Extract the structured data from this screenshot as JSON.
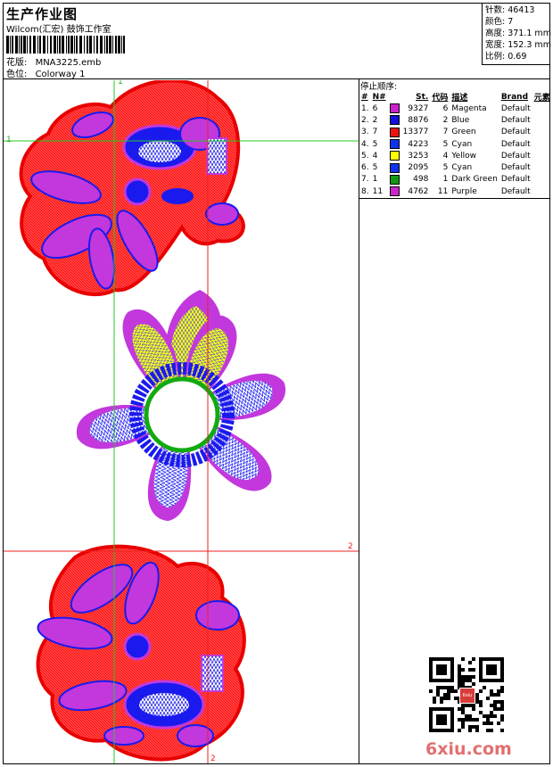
{
  "header": {
    "title": "生产作业图",
    "company": "Wilcom(汇宏) 鼓饰工作室",
    "design_label": "花版:",
    "design_file": "MNA3225.emb",
    "colorway_label": "色位:",
    "colorway": "Colorway 1"
  },
  "stats": {
    "stitches": "针数: 46413",
    "colors": "颜色: 7",
    "height": "高度: 371.1 mm",
    "width": "宽度: 152.3 mm",
    "scale": "比例: 0.69"
  },
  "stop_sequence": {
    "label": "停止顺序:",
    "columns": [
      "#",
      "N#",
      "",
      "St.",
      "代码",
      "描述",
      "Brand",
      "元素"
    ],
    "rows": [
      {
        "num": "1.",
        "n": "6",
        "color": "#cc22cc",
        "st": "9327",
        "code": "6",
        "desc": "Magenta",
        "brand": "Default"
      },
      {
        "num": "2.",
        "n": "2",
        "color": "#1111dd",
        "st": "8876",
        "code": "2",
        "desc": "Blue",
        "brand": "Default"
      },
      {
        "num": "3.",
        "n": "7",
        "color": "#ee1111",
        "st": "13377",
        "code": "7",
        "desc": "Green",
        "brand": "Default"
      },
      {
        "num": "4.",
        "n": "5",
        "color": "#1133ee",
        "st": "4223",
        "code": "5",
        "desc": "Cyan",
        "brand": "Default"
      },
      {
        "num": "5.",
        "n": "4",
        "color": "#ffff00",
        "st": "3253",
        "code": "4",
        "desc": "Yellow",
        "brand": "Default"
      },
      {
        "num": "6.",
        "n": "5",
        "color": "#1133ee",
        "st": "2095",
        "code": "5",
        "desc": "Cyan",
        "brand": "Default"
      },
      {
        "num": "7.",
        "n": "1",
        "color": "#119911",
        "st": "498",
        "code": "1",
        "desc": "Dark Green",
        "brand": "Default"
      },
      {
        "num": "8.",
        "n": "11",
        "color": "#cc22cc",
        "st": "4762",
        "code": "11",
        "desc": "Purple",
        "brand": "Default"
      }
    ]
  },
  "guides": {
    "v1": "1",
    "h1": "1",
    "v2": "2",
    "h2": "2"
  },
  "qr_badge": "6xiu",
  "watermark": {
    "main": "6xiu",
    "tld": ".com"
  },
  "colors": {
    "red": "#ff1a1a",
    "magenta": "#cc33dd",
    "blue": "#1a1aee",
    "yellow": "#ffff22",
    "green": "#11aa11",
    "guide_green": "#22cc22",
    "guide_red": "#ee2222"
  }
}
